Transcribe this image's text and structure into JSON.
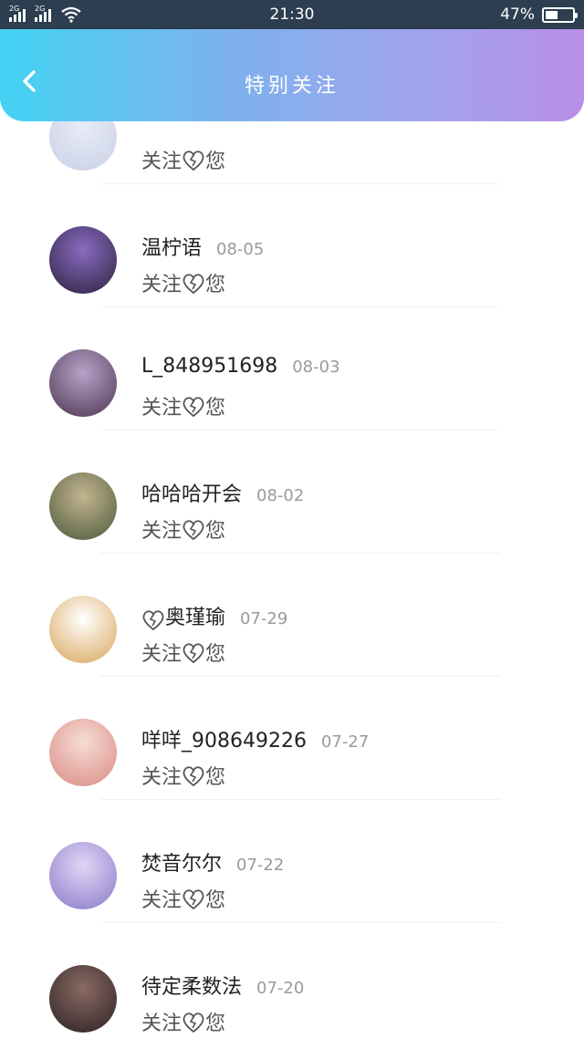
{
  "status_bar": {
    "sim1": "2G",
    "sim2": "2G",
    "time": "21:30",
    "battery_text": "47%",
    "battery_level": 0.47
  },
  "header": {
    "title": "特别关注"
  },
  "items": [
    {
      "name": "",
      "date": "",
      "sub": [
        "关注",
        "您"
      ],
      "avatar_colors": [
        "#e8ecf6",
        "#c9d0e6"
      ]
    },
    {
      "name": "温柠语",
      "date": "08-05",
      "sub": [
        "关注",
        "您"
      ],
      "avatar_colors": [
        "#8a6cc0",
        "#2d2240"
      ]
    },
    {
      "name": "L_848951698",
      "date": "08-03",
      "sub": [
        "关注",
        "您"
      ],
      "avatar_colors": [
        "#b7a3c9",
        "#4d3550"
      ]
    },
    {
      "name": "哈哈哈开会",
      "date": "08-02",
      "sub": [
        "关注",
        "您"
      ],
      "avatar_colors": [
        "#c4b48f",
        "#4a5a3c"
      ]
    },
    {
      "name": "奥瑾瑜",
      "name_prefix_heart": true,
      "date": "07-29",
      "sub": [
        "关注",
        "您"
      ],
      "avatar_colors": [
        "#ffffff",
        "#d9a55a"
      ]
    },
    {
      "name": "咩咩_908649226",
      "date": "07-27",
      "sub": [
        "关注",
        "您"
      ],
      "avatar_colors": [
        "#f6dcd4",
        "#d98b84"
      ]
    },
    {
      "name": "焚音尔尔",
      "date": "07-22",
      "sub": [
        "关注",
        "您"
      ],
      "avatar_colors": [
        "#e1d5f5",
        "#8a7ac8"
      ]
    },
    {
      "name": "待定柔数法",
      "date": "07-20",
      "sub": [
        "关注",
        "您"
      ],
      "avatar_colors": [
        "#8b6a63",
        "#2b2224"
      ]
    }
  ]
}
